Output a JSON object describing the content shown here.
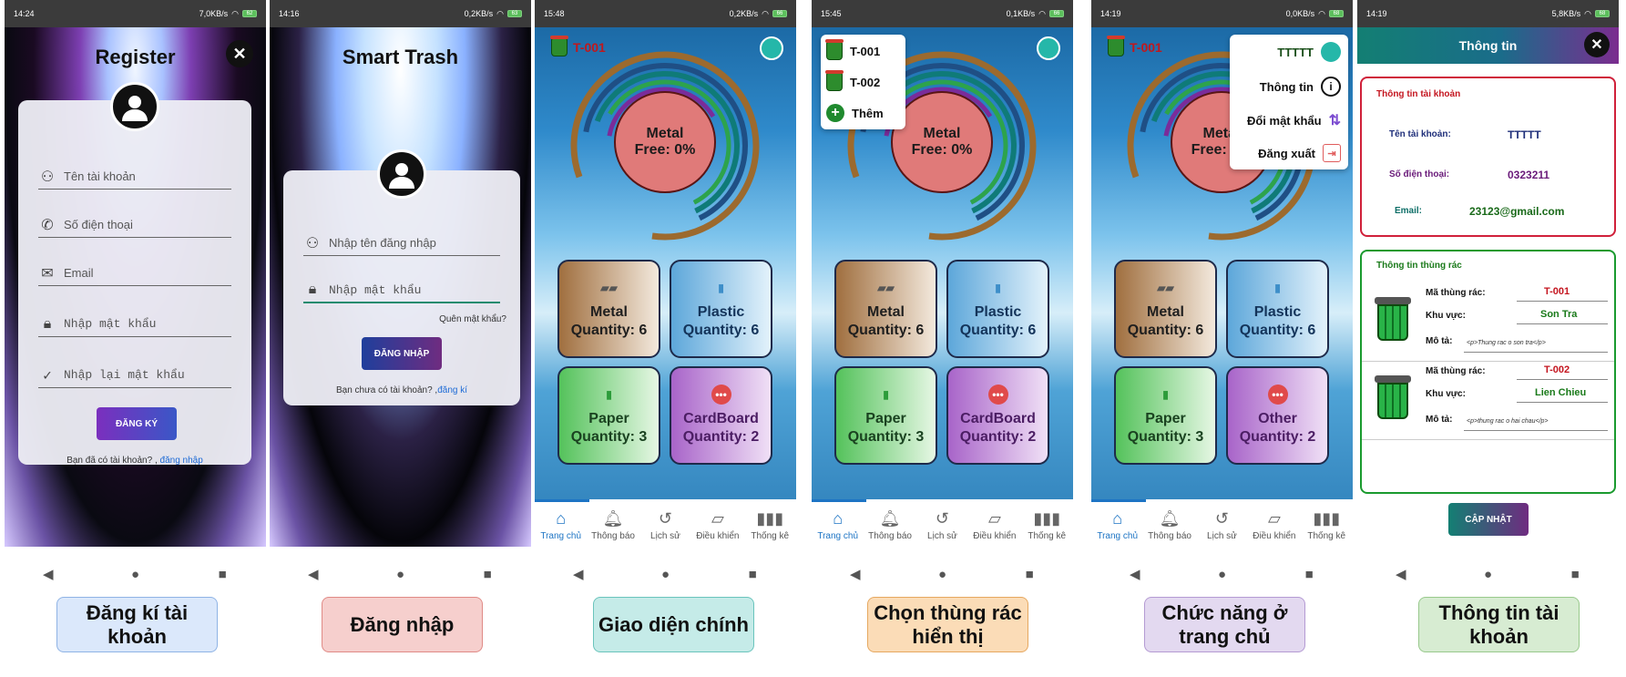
{
  "screens": {
    "register": {
      "status": {
        "time": "14:24",
        "speed": "7,0KB/s",
        "battery": "62"
      },
      "title": "Register",
      "close_glyph": "✕",
      "fields": [
        {
          "placeholder": "Tên tài khoản",
          "icon": "user-icon"
        },
        {
          "placeholder": "Số điện thoại",
          "icon": "phone-icon"
        },
        {
          "placeholder": "Email",
          "icon": "mail-icon"
        },
        {
          "placeholder": "Nhập mật khẩu",
          "icon": "lock-icon"
        },
        {
          "placeholder": "Nhập lại mật khẩu",
          "icon": "check-circle-icon"
        }
      ],
      "button": "ĐĂNG KÝ",
      "footer_text": "Bạn đã có tài khoản? ,",
      "footer_link": "đăng nhập"
    },
    "login": {
      "status": {
        "time": "14:16",
        "speed": "0,2KB/s",
        "battery": "63"
      },
      "title": "Smart Trash",
      "fields": [
        {
          "placeholder": "Nhập tên đăng nhập",
          "icon": "user-icon"
        },
        {
          "placeholder": "Nhập mật khẩu",
          "icon": "lock-icon"
        }
      ],
      "forgot": "Quên mật khẩu?",
      "button": "ĐĂNG NHẬP",
      "footer_text": "Bạn chưa có tài khoản? ,",
      "footer_link": "đăng kí"
    },
    "main": {
      "status": {
        "time": "15:48",
        "speed": "0,2KB/s",
        "battery": "66"
      },
      "bin_id": "T-001",
      "center_label": "Metal",
      "center_value": "Free: 0%",
      "tiles": [
        {
          "name": "Metal",
          "qty": "Quantity: 6",
          "icon": "metal-bars-icon"
        },
        {
          "name": "Plastic",
          "qty": "Quantity: 6",
          "icon": "bottle-icon"
        },
        {
          "name": "Paper",
          "qty": "Quantity: 3",
          "icon": "document-icon"
        },
        {
          "name": "CardBoard",
          "qty": "Quantity: 2",
          "icon": "dots-icon"
        }
      ],
      "nav": [
        "Trang chủ",
        "Thông báo",
        "Lịch sử",
        "Điều khiển",
        "Thống kê"
      ]
    },
    "select_bin": {
      "status": {
        "time": "15:45",
        "speed": "0,1KB/s",
        "battery": "66"
      },
      "menu": [
        "T-001",
        "T-002",
        "Thêm"
      ],
      "center_label": "Metal",
      "center_value": "Free: 0%",
      "tiles": [
        {
          "name": "Metal",
          "qty": "Quantity: 6"
        },
        {
          "name": "Plastic",
          "qty": "Quantity: 6"
        },
        {
          "name": "Paper",
          "qty": "Quantity: 3"
        },
        {
          "name": "CardBoard",
          "qty": "Quantity: 2"
        }
      ],
      "nav": [
        "Trang chủ",
        "Thông báo",
        "Lịch sử",
        "Điều khiển",
        "Thống kê"
      ]
    },
    "home_functions": {
      "status": {
        "time": "14:19",
        "speed": "0,0KB/s",
        "battery": "68"
      },
      "bin_id": "T-001",
      "center_label": "Metal",
      "center_value": "Free: 0%",
      "menu": [
        {
          "label": "TTTTT",
          "icon": "user-circle-icon"
        },
        {
          "label": "Thông tin",
          "icon": "info-icon"
        },
        {
          "label": "Đổi mật khẩu",
          "icon": "swap-icon"
        },
        {
          "label": "Đăng xuất",
          "icon": "logout-icon"
        }
      ],
      "tiles": [
        {
          "name": "Metal",
          "qty": "Quantity: 6"
        },
        {
          "name": "Plastic",
          "qty": "Quantity: 6"
        },
        {
          "name": "Paper",
          "qty": "Quantity: 3"
        },
        {
          "name": "Other",
          "qty": "Quantity: 2"
        }
      ],
      "nav": [
        "Trang chủ",
        "Thông báo",
        "Lịch sử",
        "Điều khiển",
        "Thống kê"
      ]
    },
    "account_info": {
      "status": {
        "time": "14:19",
        "speed": "5,8KB/s",
        "battery": "68"
      },
      "header": "Thông tin",
      "account_title": "Thông tin tài khoản",
      "account": [
        {
          "label": "Tên tài khoản:",
          "value": "TTTTT"
        },
        {
          "label": "Số điện thoại:",
          "value": "0323211"
        },
        {
          "label": "Email:",
          "value": "23123@gmail.com"
        }
      ],
      "bins_title": "Thông tin thùng rác",
      "bins": [
        {
          "id_label": "Mã thùng rác:",
          "id": "T-001",
          "area_label": "Khu vực:",
          "area": "Son Tra",
          "desc_label": "Mô tả:",
          "desc": "<p>Thung rac o son tra</p>"
        },
        {
          "id_label": "Mã thùng rác:",
          "id": "T-002",
          "area_label": "Khu vực:",
          "area": "Lien Chieu",
          "desc_label": "Mô tả:",
          "desc": "<p>thung rac o hai chau</p>"
        }
      ],
      "button": "CẬP NHẬT"
    }
  },
  "captions": [
    {
      "text": "Đăng kí tài khoản",
      "bg": "#dbe8fb",
      "border": "#8fb3e5"
    },
    {
      "text": "Đăng nhập",
      "bg": "#f6cfcd",
      "border": "#e08a86"
    },
    {
      "text": "Giao diện chính",
      "bg": "#c5ebe8",
      "border": "#6ac4bc"
    },
    {
      "text": "Chọn thùng rác hiển thị",
      "bg": "#fbdcb7",
      "border": "#e6a860"
    },
    {
      "text": "Chức năng ở trang chủ",
      "bg": "#e3d9f0",
      "border": "#b49ad3"
    },
    {
      "text": "Thông tin tài khoản",
      "bg": "#d7ecd2",
      "border": "#98c98c"
    }
  ],
  "android_nav": [
    "◀",
    "●",
    "■"
  ]
}
